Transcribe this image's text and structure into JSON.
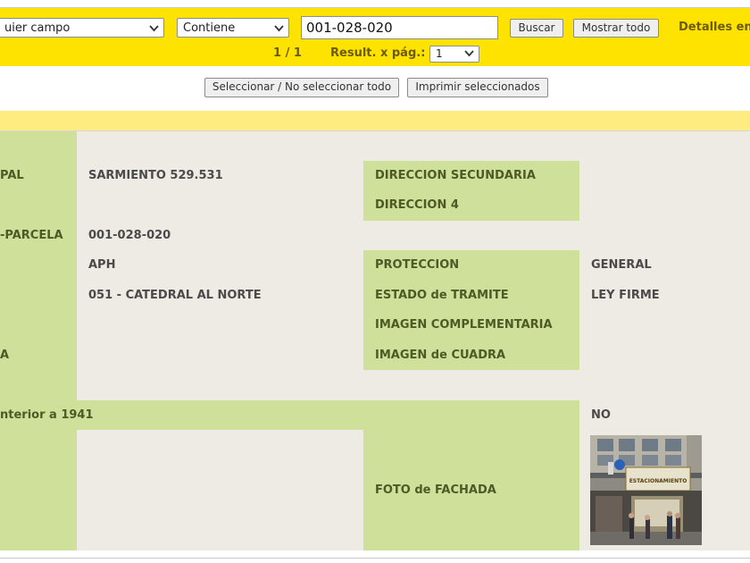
{
  "search": {
    "field_select": "uier campo",
    "operator_select": "Contiene",
    "query_value": "001-028-020",
    "search_button": "Buscar",
    "show_all_button": "Mostrar todo",
    "details_link": "Detalles en",
    "pagination": "1 / 1",
    "results_per_page_label": "Result. x pág.:",
    "results_per_page_value": "1"
  },
  "actions": {
    "select_toggle": "Seleccionar / No seleccionar todo",
    "print_selected": "Imprimir seleccionados"
  },
  "record": {
    "rows": [
      {
        "label_a": "",
        "value_a": ""
      },
      {
        "label_a": "PAL",
        "value_a": "SARMIENTO 529.531",
        "label_b": "DIRECCION SECUNDARIA",
        "value_b": ""
      },
      {
        "label_a": "",
        "value_a": "",
        "label_b": "DIRECCION 4",
        "value_b": ""
      },
      {
        "label_a": "-PARCELA",
        "value_a": "001-028-020"
      },
      {
        "label_a": "",
        "value_a": "APH",
        "label_b": "PROTECCION",
        "value_b": "GENERAL"
      },
      {
        "label_a": "",
        "value_a": "051 - CATEDRAL AL NORTE",
        "label_b": "ESTADO de TRAMITE",
        "value_b": "LEY FIRME"
      },
      {
        "label_a": "",
        "value_a": "",
        "label_b": "IMAGEN COMPLEMENTARIA",
        "value_b": ""
      },
      {
        "label_a": "A",
        "value_a": "",
        "label_b": "IMAGEN de CUADRA",
        "value_b": ""
      },
      {
        "label_a": "",
        "value_a": ""
      },
      {
        "label_a": "nterior a 1941",
        "value_b": "NO"
      },
      {
        "label_a": "",
        "value_a": "",
        "label_b": "FOTO de FACHADA"
      }
    ],
    "photo_sign_text": "ESTACIONAMIENTO"
  },
  "colors": {
    "search_bar": "#ffe300",
    "band": "#ffec80",
    "label_cell": "#cfe09a",
    "value_cell": "#eeebe5"
  },
  "icons": {
    "dropdown": "chevron-down-icon"
  }
}
